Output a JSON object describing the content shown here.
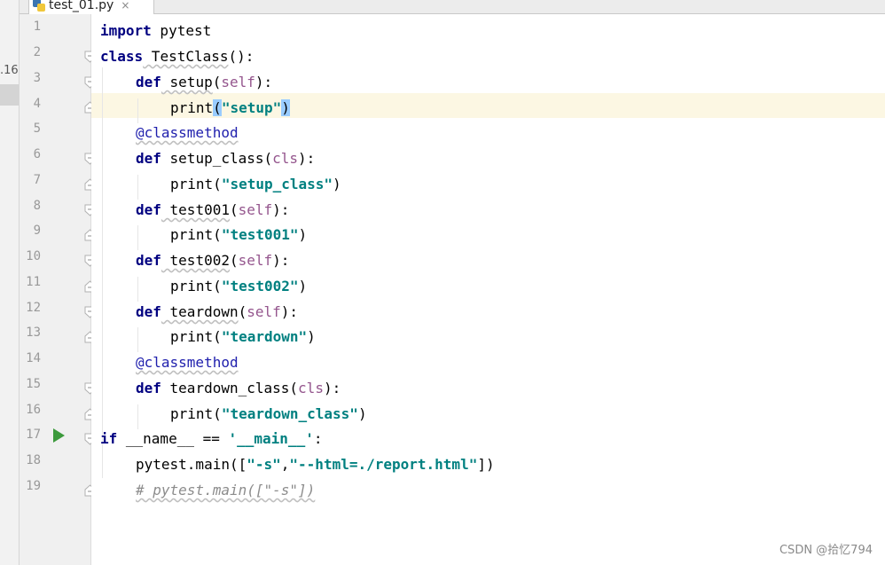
{
  "left_panel": {
    "partial_number": ".16"
  },
  "tab": {
    "file_name": "test_01.py",
    "close_glyph": "×"
  },
  "gutter": {
    "line_numbers": [
      "1",
      "2",
      "3",
      "4",
      "5",
      "6",
      "7",
      "8",
      "9",
      "10",
      "11",
      "12",
      "13",
      "14",
      "15",
      "16",
      "17",
      "18",
      "19"
    ],
    "run_line": "17"
  },
  "code": {
    "l1": {
      "kw": "import",
      "rest": " pytest"
    },
    "l2": {
      "kw": "class",
      "name": " TestClass",
      "tail": "():"
    },
    "l3": {
      "kw": "def",
      "name": " setup",
      "open": "(",
      "self": "self",
      "close": "):"
    },
    "l4": {
      "fn": "print",
      "open": "(",
      "str": "\"setup\"",
      "close": ")"
    },
    "l5": {
      "deco": "@classmethod"
    },
    "l6": {
      "kw": "def",
      "name": " setup_class",
      "open": "(",
      "self": "cls",
      "close": "):"
    },
    "l7": {
      "fn": "print",
      "open": "(",
      "str": "\"setup_class\"",
      "close": ")"
    },
    "l8": {
      "kw": "def",
      "name": " test001",
      "open": "(",
      "self": "self",
      "close": "):"
    },
    "l9": {
      "fn": "print",
      "open": "(",
      "str": "\"test001\"",
      "close": ")"
    },
    "l10": {
      "kw": "def",
      "name": " test002",
      "open": "(",
      "self": "self",
      "close": "):"
    },
    "l11": {
      "fn": "print",
      "open": "(",
      "str": "\"test002\"",
      "close": ")"
    },
    "l12": {
      "kw": "def",
      "name": " teardown",
      "open": "(",
      "self": "self",
      "close": "):"
    },
    "l13": {
      "fn": "print",
      "open": "(",
      "str": "\"teardown\"",
      "close": ")"
    },
    "l14": {
      "deco": "@classmethod"
    },
    "l15": {
      "kw": "def",
      "name": " teardown_class",
      "open": "(",
      "self": "cls",
      "close": "):"
    },
    "l16": {
      "fn": "print",
      "open": "(",
      "str": "\"teardown_class\"",
      "close": ")"
    },
    "l17": {
      "kw": "if",
      "mid": " __name__ == ",
      "str": "'__main__'",
      "close": ":"
    },
    "l18": {
      "pre": "pytest.main([",
      "str1": "\"-s\"",
      "comma": ",",
      "str2": "\"--html=./report.html\"",
      "close": "])"
    },
    "l19": {
      "comment": "# pytest.main([\"-s\"])"
    }
  },
  "watermark": "CSDN @拾忆794"
}
